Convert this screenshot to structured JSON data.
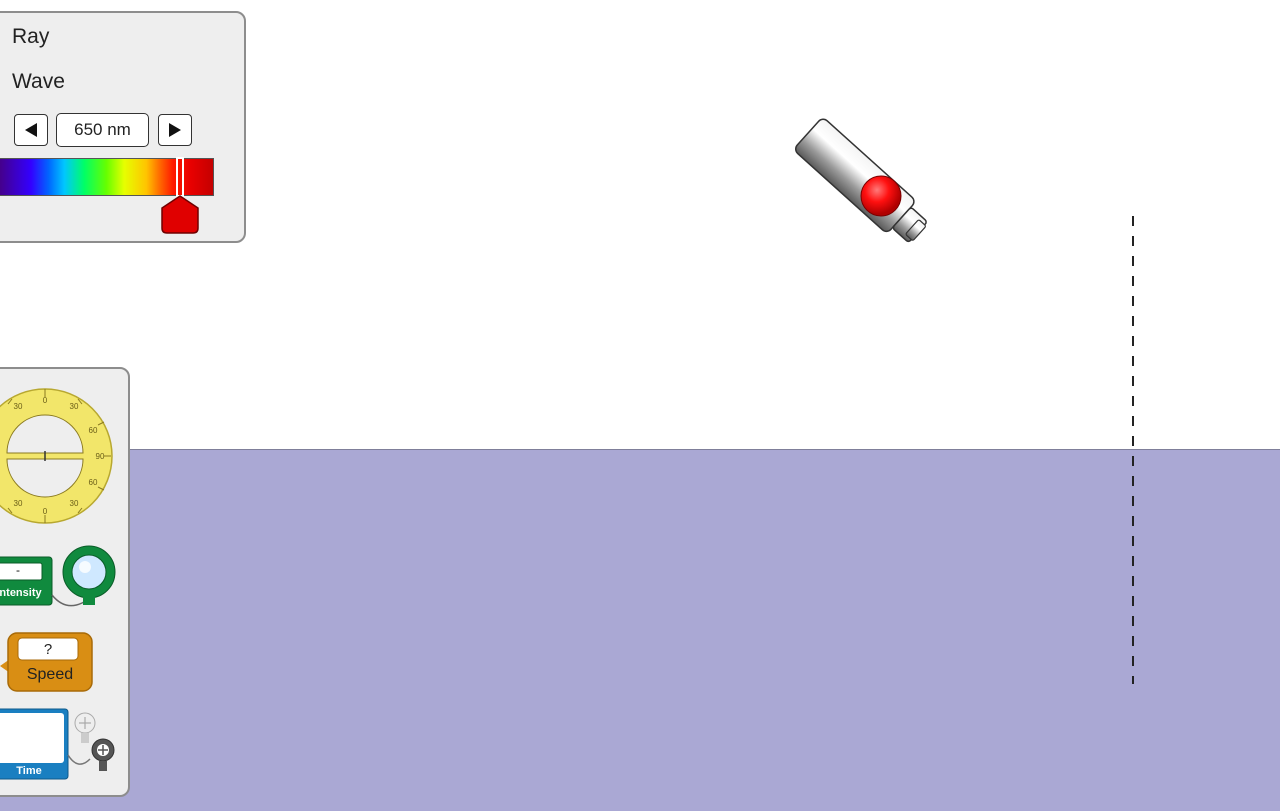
{
  "light_panel": {
    "modes": [
      {
        "label": "Ray"
      },
      {
        "label": "Wave"
      }
    ],
    "wavelength_display": "650 nm",
    "wavelength_nm": 650,
    "slider_fraction": 0.8
  },
  "toolbox": {
    "protractor_ticks": [
      "30",
      "0",
      "30",
      "60",
      "90",
      "60",
      "30",
      "0",
      "30"
    ],
    "intensity": {
      "value": "-",
      "label": "Intensity"
    },
    "speed": {
      "value": "?",
      "label": "Speed"
    },
    "time": {
      "label": "Time"
    }
  },
  "colors": {
    "water": "#aaa8d4",
    "panel": "#eeeeee",
    "laser_button": "#ff0000",
    "intensity_green": "#108a3e",
    "speed_orange": "#d98e14",
    "time_blue": "#1a7fc1"
  },
  "icons": [
    "left-arrow-icon",
    "right-arrow-icon",
    "slider-thumb-icon",
    "laser-icon",
    "protractor-icon",
    "intensity-probe-icon",
    "speed-tool-icon",
    "time-tool-icon"
  ]
}
